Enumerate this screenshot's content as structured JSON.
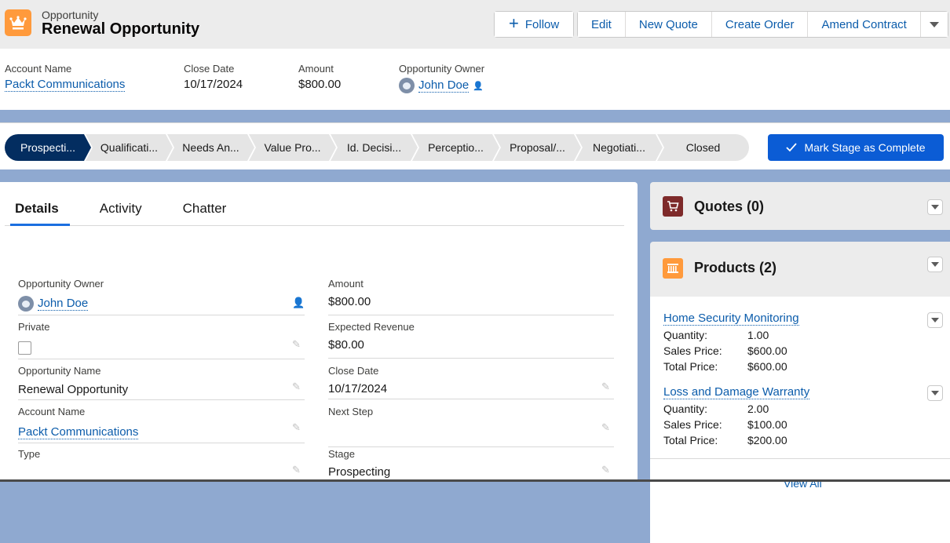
{
  "header": {
    "object_type": "Opportunity",
    "title": "Renewal Opportunity",
    "object_icon": "crown-icon",
    "actions": {
      "follow": "Follow",
      "edit": "Edit",
      "new_quote": "New Quote",
      "create_order": "Create Order",
      "amend_contract": "Amend Contract"
    }
  },
  "highlights": [
    {
      "label": "Account Name",
      "value": "Packt Communications"
    },
    {
      "label": "Close Date",
      "value": "10/17/2024"
    },
    {
      "label": "Amount",
      "value": "$800.00"
    },
    {
      "label": "Opportunity Owner",
      "value": "John Doe"
    }
  ],
  "path": {
    "stages": [
      "Prospecti...",
      "Qualificati...",
      "Needs An...",
      "Value Pro...",
      "Id. Decisi...",
      "Perceptio...",
      "Proposal/...",
      "Negotiati...",
      "Closed"
    ],
    "active_index": 0,
    "mark_complete": "Mark Stage as Complete"
  },
  "tabs": [
    "Details",
    "Activity",
    "Chatter"
  ],
  "details": {
    "left": [
      {
        "label": "Opportunity Owner",
        "value": "John Doe",
        "type": "user-link"
      },
      {
        "label": "Private",
        "value": "",
        "type": "checkbox",
        "checked": false
      },
      {
        "label": "Opportunity Name",
        "value": "Renewal Opportunity",
        "type": "text"
      },
      {
        "label": "Account Name",
        "value": "Packt Communications",
        "type": "link"
      },
      {
        "label": "Type",
        "value": "",
        "type": "text"
      }
    ],
    "right": [
      {
        "label": "Amount",
        "value": "$800.00"
      },
      {
        "label": "Expected Revenue",
        "value": "$80.00"
      },
      {
        "label": "Close Date",
        "value": "10/17/2024"
      },
      {
        "label": "Next Step",
        "value": ""
      },
      {
        "label": "Stage",
        "value": "Prospecting"
      }
    ]
  },
  "quotes": {
    "title": "Quotes (0)"
  },
  "products": {
    "title": "Products (2)",
    "items": [
      {
        "name": "Home Security Monitoring",
        "quantity_label": "Quantity:",
        "quantity": "1.00",
        "sales_price_label": "Sales Price:",
        "sales_price": "$600.00",
        "total_price_label": "Total Price:",
        "total_price": "$600.00"
      },
      {
        "name": "Loss and Damage Warranty",
        "quantity_label": "Quantity:",
        "quantity": "2.00",
        "sales_price_label": "Sales Price:",
        "sales_price": "$100.00",
        "total_price_label": "Total Price:",
        "total_price": "$200.00"
      }
    ],
    "view_all": "View All"
  },
  "colors": {
    "brand_blue": "#0b5cab",
    "path_active": "#032d60",
    "primary_button": "#0b5cd5",
    "opportunity_icon": "#ff9a3c",
    "quotes_icon": "#7e2a2a",
    "products_icon": "#ff9a3c"
  }
}
